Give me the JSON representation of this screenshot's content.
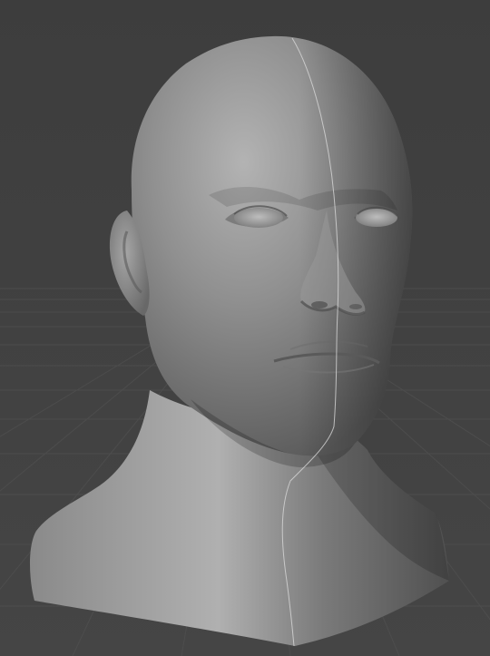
{
  "viewport": {
    "background_color": "#3f3f3f",
    "grid_color": "#4c4c4c",
    "model": {
      "kind": "sculpted-head-bust",
      "material_color": "#8a8a8a",
      "seam_line_color": "#d8d8d8"
    }
  }
}
